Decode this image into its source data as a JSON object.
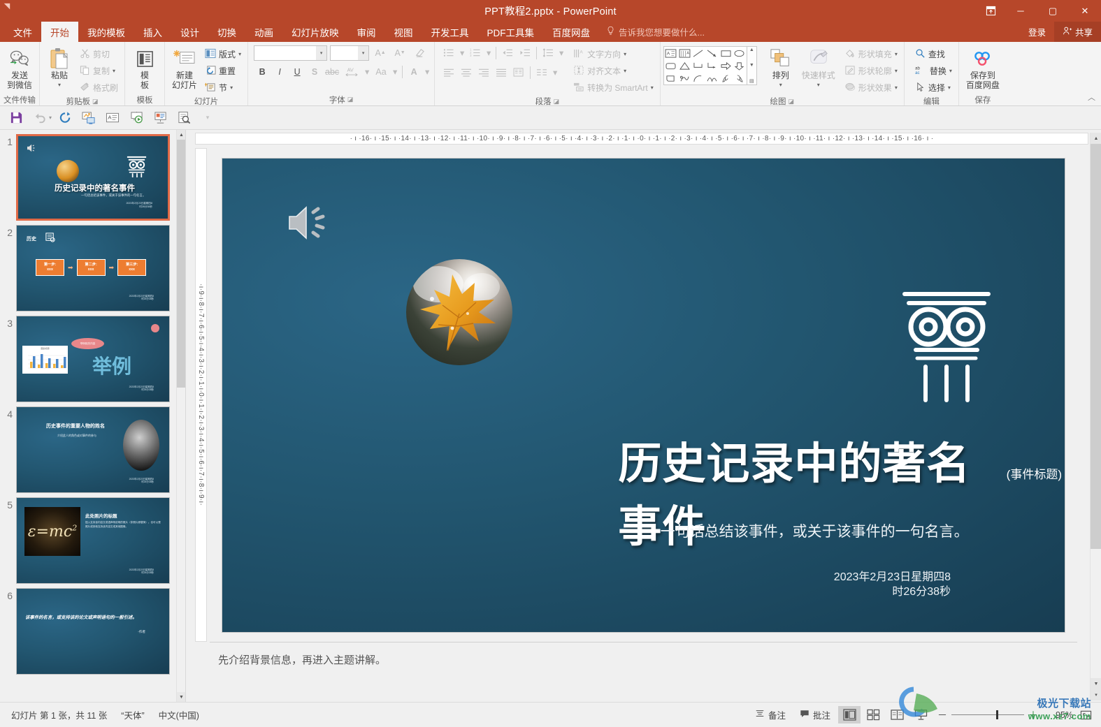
{
  "titlebar": {
    "title": "PPT教程2.pptx - PowerPoint",
    "ribbon_display_options": "▣",
    "minimize": "－",
    "maximize": "▢",
    "close": "✕"
  },
  "menubar": {
    "items": [
      {
        "label": "文件",
        "active": false
      },
      {
        "label": "开始",
        "active": true
      },
      {
        "label": "我的模板",
        "active": false
      },
      {
        "label": "插入",
        "active": false
      },
      {
        "label": "设计",
        "active": false
      },
      {
        "label": "切换",
        "active": false
      },
      {
        "label": "动画",
        "active": false
      },
      {
        "label": "幻灯片放映",
        "active": false
      },
      {
        "label": "审阅",
        "active": false
      },
      {
        "label": "视图",
        "active": false
      },
      {
        "label": "开发工具",
        "active": false
      },
      {
        "label": "PDF工具集",
        "active": false
      },
      {
        "label": "百度网盘",
        "active": false
      }
    ],
    "tell_me": "告诉我您想要做什么...",
    "sign_in": "登录",
    "share": "共享"
  },
  "ribbon": {
    "groups": [
      {
        "name": "文件传输"
      },
      {
        "name": "剪贴板"
      },
      {
        "name": "模板"
      },
      {
        "name": "幻灯片"
      },
      {
        "name": "字体"
      },
      {
        "name": "段落"
      },
      {
        "name": "绘图"
      },
      {
        "name": "编辑"
      },
      {
        "name": "保存"
      }
    ],
    "wechat_send": "发送\n到微信",
    "wechat_line1": "发送",
    "wechat_line2": "到微信",
    "paste": "粘贴",
    "cut": "剪切",
    "copy": "复制",
    "format_painter": "格式刷",
    "template_line1": "模",
    "template_line2": "板",
    "new_slide_line1": "新建",
    "new_slide_line2": "幻灯片",
    "layout": "版式",
    "reset": "重置",
    "section": "节",
    "font_name": "",
    "font_size": "",
    "text_direction": "文字方向",
    "align_text": "对齐文本",
    "convert_smartart": "转换为 SmartArt",
    "arrange_line1": "排列",
    "quickstyle_line1": "快速样式",
    "shape_fill": "形状填充",
    "shape_outline": "形状轮廓",
    "shape_effects": "形状效果",
    "find": "查找",
    "replace": "替换",
    "select": "选择",
    "save_baidu_line1": "保存到",
    "save_baidu_line2": "百度网盘",
    "collapse": "︿"
  },
  "rulers": {
    "horizontal_left": "·  ı  ·16·  ı  ·15·  ı  ·14·  ı  ·13·  ı  ·12·  ı  ·11·  ı  ·10·  ı  ·9·  ı  ·8·  ı  ·7·  ı  ·6·  ı  ·5·  ı  ·4·  ı  ·3·  ı  ·2·  ı  ·1·  ı  ·",
    "horizontal_right": "0·  ı  ·1·  ı  ·2·  ı  ·3·  ı  ·4·  ı  ·5·  ı  ·6·  ı  ·7·  ı  ·8·  ı  ·9·  ı  ·10·  ı  ·11·  ı  ·12·  ı  ·13·  ı  ·14·  ı  ·15·  ı  ·16·  ı  ·",
    "vertical": "·ı·9·ı·8·ı·7·ı·6·ı·5·ı·4·ı·3·ı·2·ı·1·ı·0·ı·1·ı·2·ı·3·ı·4·ı·5·ı·6·ı·7·ı·8·ı·9·ı·"
  },
  "thumbnails": [
    {
      "num": "1",
      "selected": true,
      "kind": "title"
    },
    {
      "num": "2",
      "selected": false,
      "kind": "process",
      "heading": "历史",
      "steps": [
        "第一步:",
        "第二步:",
        "第三步:"
      ],
      "step_sub": "xxx"
    },
    {
      "num": "3",
      "selected": false,
      "kind": "chart",
      "big_text": "举例",
      "bubble": "举例相关内容"
    },
    {
      "num": "4",
      "selected": false,
      "kind": "person",
      "heading": "历史事件的重要人物的姓名",
      "sub": "介绍此人的角色或对事件的参与"
    },
    {
      "num": "5",
      "selected": false,
      "kind": "photo",
      "heading": "此处照片的标题",
      "sub": "插入支持该内容文或语声明说明的照片（非照片即替换）。也可以是照片或其他支持该内容文或其他图像。"
    },
    {
      "num": "6",
      "selected": false,
      "kind": "quote",
      "text": "该事件的名言，或支持该的论文或声明语句的一般引述。",
      "author": "-作者"
    }
  ],
  "slide": {
    "title_main": "历史记录中的著名事件",
    "title_tag": "(事件标题)",
    "subtitle": "一句话总结该事件，或关于该事件的一句名言。",
    "date_line1": "2023年2月23日星期四8",
    "date_line2": "时26分38秒",
    "sound_icon": "speaker-icon",
    "photo_alt": "autumn-leaf-photo",
    "column_alt": "greek-column-icon"
  },
  "notes": {
    "text": "先介绍背景信息，再进入主题讲解。"
  },
  "statusbar": {
    "slide_count": "幻灯片 第 1 张，共 11 张",
    "theme": "“天体”",
    "language": "中文(中国)",
    "notes_btn": "备注",
    "comments_btn": "批注",
    "zoom_value": "95%",
    "minus": "－",
    "plus": "＋"
  },
  "watermark": {
    "line1": "极光下载站",
    "line2": "www.xz7.com"
  }
}
